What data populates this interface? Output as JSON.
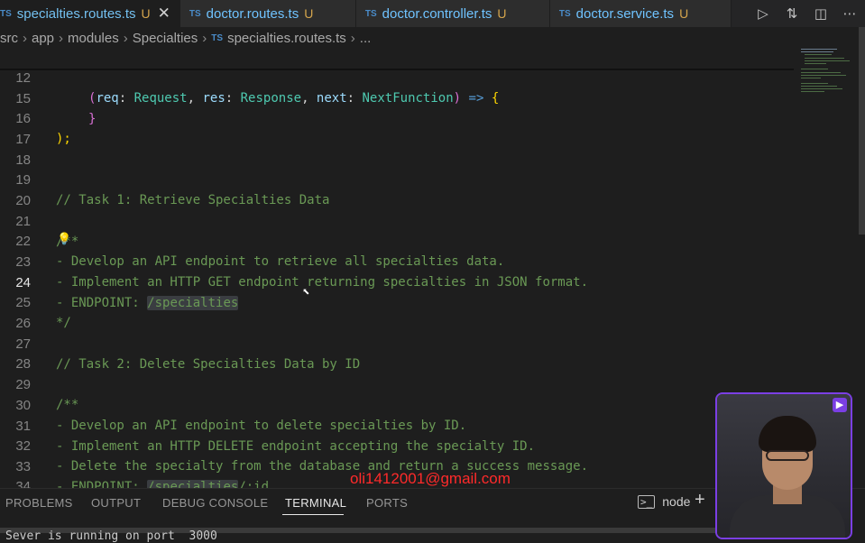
{
  "tabs": [
    {
      "icon": "TS",
      "name": "specialties.routes.ts",
      "status": "U",
      "active": true
    },
    {
      "icon": "TS",
      "name": "doctor.routes.ts",
      "status": "U",
      "active": false
    },
    {
      "icon": "TS",
      "name": "doctor.controller.ts",
      "status": "U",
      "active": false
    },
    {
      "icon": "TS",
      "name": "doctor.service.ts",
      "status": "U",
      "active": false
    }
  ],
  "tab_actions": [
    "run-icon",
    "compare-changes-icon",
    "split-editor-icon",
    "more-actions-icon"
  ],
  "breadcrumb": {
    "parts": [
      "src",
      "app",
      "modules",
      "Specialties"
    ],
    "file_icon": "TS",
    "file": "specialties.routes.ts",
    "tail": "..."
  },
  "editor": {
    "current_line": "24",
    "lines": [
      {
        "n": "12",
        "text": "(req: Request, res: Response, next: NextFunction) => {"
      },
      {
        "n": "15",
        "text": "}"
      },
      {
        "n": "16",
        "text": ");"
      },
      {
        "n": "17",
        "text": ""
      },
      {
        "n": "18",
        "text": ""
      },
      {
        "n": "19",
        "text": "// Task 1: Retrieve Specialties Data"
      },
      {
        "n": "20",
        "text": ""
      },
      {
        "n": "21",
        "text": "/**"
      },
      {
        "n": "22",
        "text": "- Develop an API endpoint to retrieve all specialties data."
      },
      {
        "n": "23",
        "text": "- Implement an HTTP GET endpoint returning specialties in JSON format."
      },
      {
        "n": "24",
        "text_a": "- ENDPOINT: ",
        "text_hl": "/specialties"
      },
      {
        "n": "25",
        "text": "*/"
      },
      {
        "n": "26",
        "text": ""
      },
      {
        "n": "27",
        "text": "// Task 2: Delete Specialties Data by ID"
      },
      {
        "n": "28",
        "text": ""
      },
      {
        "n": "29",
        "text": "/**"
      },
      {
        "n": "30",
        "text": "- Develop an API endpoint to delete specialties by ID."
      },
      {
        "n": "31",
        "text": "- Implement an HTTP DELETE endpoint accepting the specialty ID."
      },
      {
        "n": "32",
        "text": "- Delete the specialty from the database and return a success message."
      },
      {
        "n": "33",
        "text_a": "- ENDPOINT: ",
        "text_hl": "/specialties",
        "text_b": "/:id"
      },
      {
        "n": "34",
        "text": "*/"
      }
    ],
    "line12_tokens": {
      "p1": "(",
      "req": "req",
      "c1": ": ",
      "Request": "Request",
      "s1": ", ",
      "res": "res",
      "c2": ": ",
      "Response": "Response",
      "s2": ", ",
      "next": "next",
      "c3": ": ",
      "NextFunction": "NextFunction",
      "p2": ")",
      "arrow": " => ",
      "brace": "{"
    }
  },
  "watermark": "oli1412001@gmail.com",
  "panel": {
    "tabs": [
      "PROBLEMS",
      "OUTPUT",
      "DEBUG CONSOLE",
      "TERMINAL",
      "PORTS"
    ],
    "active_tab": "TERMINAL",
    "terminal_name": "node",
    "terminal_icon": ">_",
    "terminal_output": "Sever is running on port  3000"
  },
  "colors": {
    "editor_bg": "#1e1e1e",
    "comment": "#6a9955",
    "accent_purple": "#7b3fe4",
    "watermark_red": "#ff2a2a"
  }
}
